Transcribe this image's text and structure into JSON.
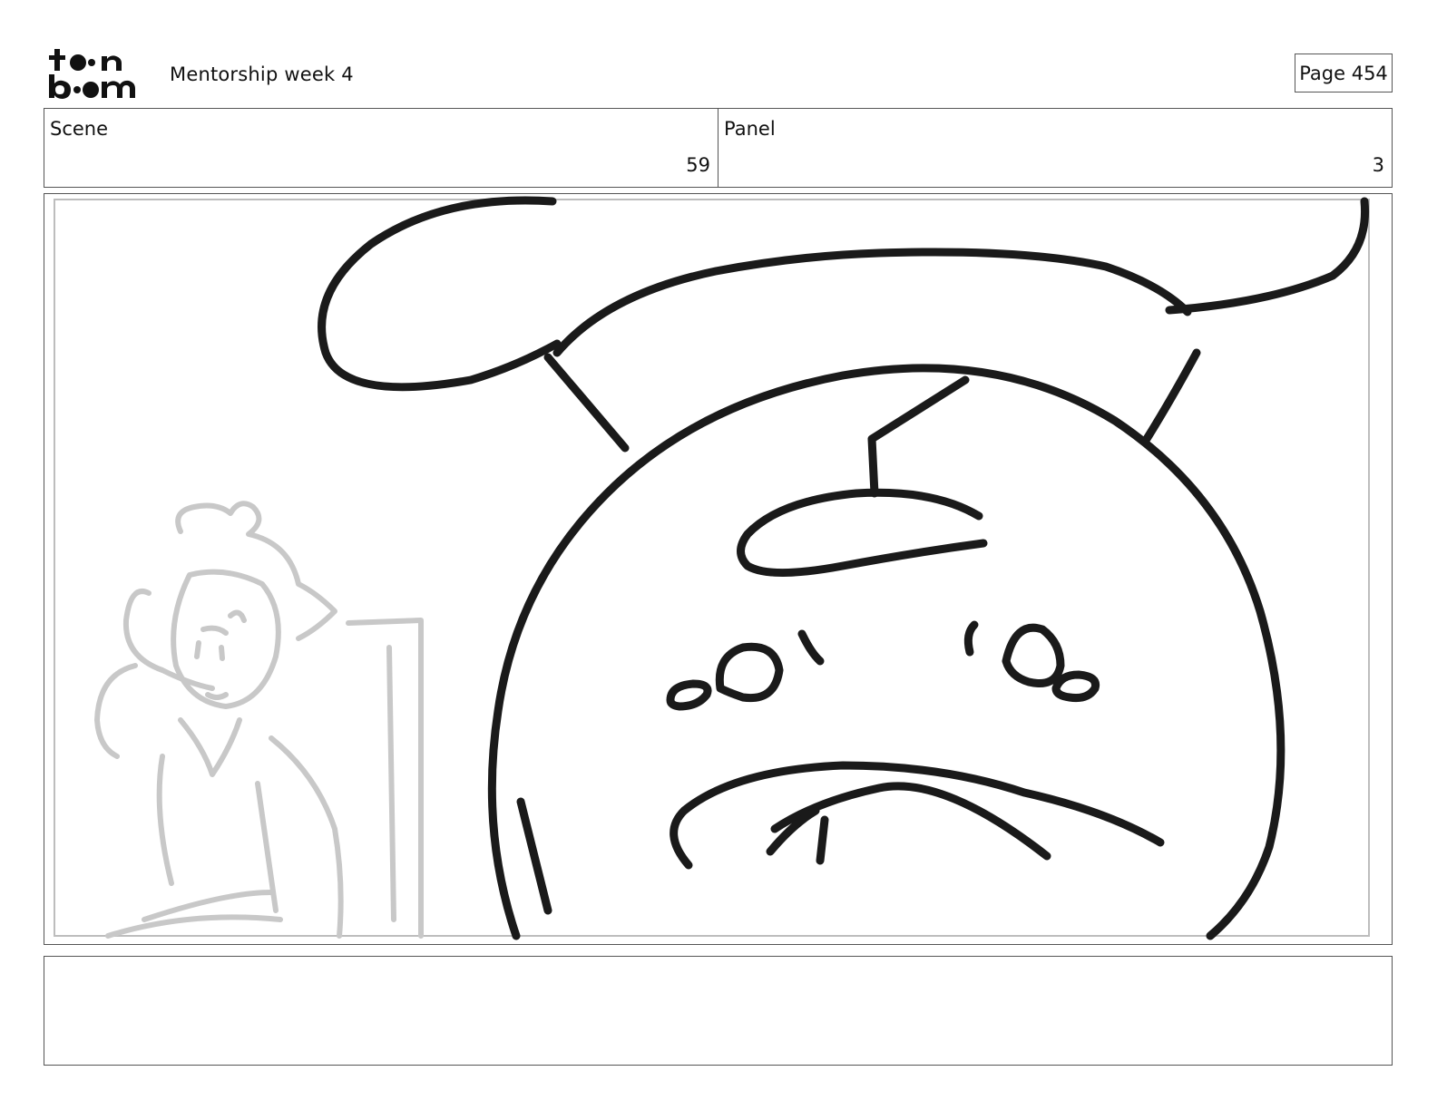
{
  "header": {
    "logo_text": "toon boom",
    "project_title": "Mentorship week 4",
    "page_label": "Page 454"
  },
  "scene": {
    "label": "Scene",
    "value": "59"
  },
  "panel": {
    "label": "Panel",
    "value": "3"
  },
  "drawing": {
    "foreground": "upside-down round character with sad face and hat",
    "background": "faint grey sketch of a person seated at a desk"
  },
  "notes": {
    "text": ""
  },
  "colors": {
    "ink": "#1a1a1a",
    "sketch": "#c8c8c8",
    "border": "#555555"
  }
}
